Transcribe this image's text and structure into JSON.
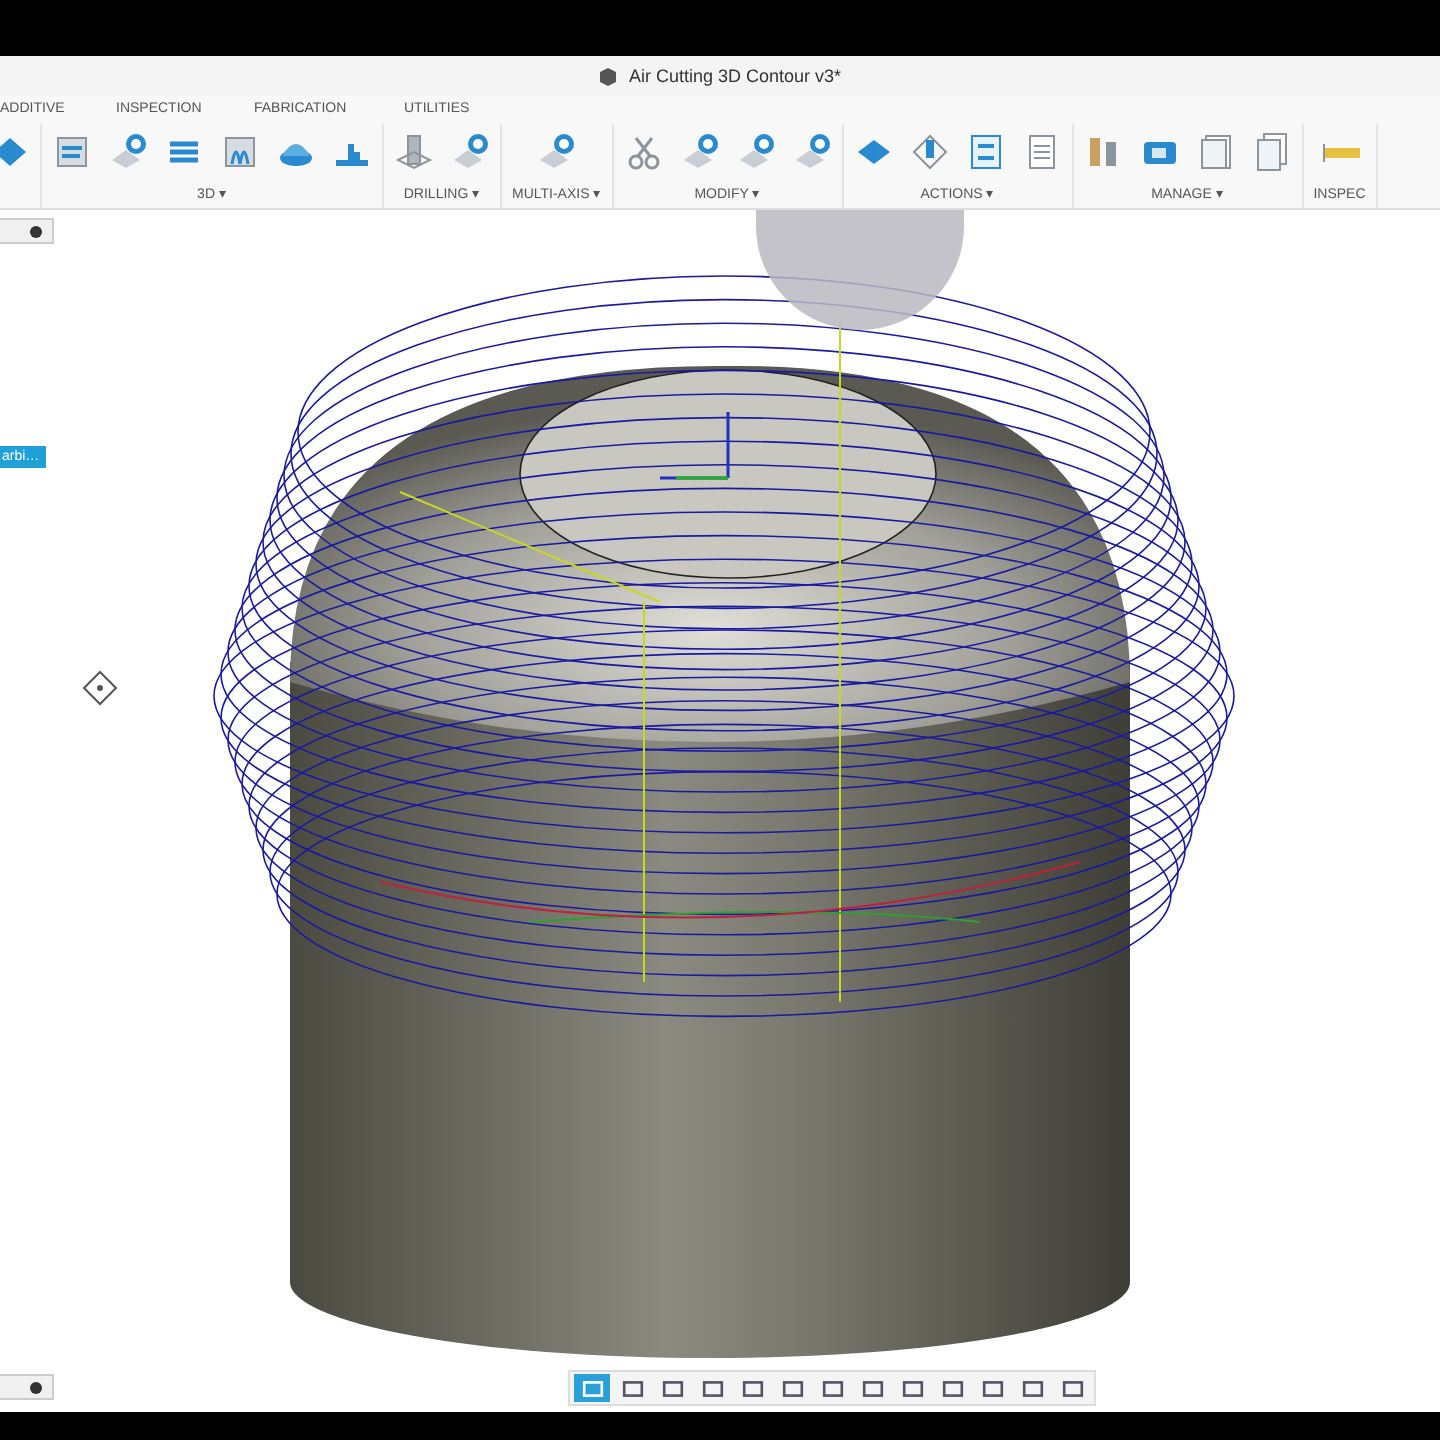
{
  "window": {
    "title": "Air Cutting 3D Contour v3*"
  },
  "ribbon_tabs": [
    {
      "label": "ADDITIVE"
    },
    {
      "label": "INSPECTION"
    },
    {
      "label": "FABRICATION"
    },
    {
      "label": "UTILITIES"
    }
  ],
  "tool_groups": [
    {
      "label": "3D ▾"
    },
    {
      "label": "DRILLING ▾"
    },
    {
      "label": "MULTI-AXIS ▾"
    },
    {
      "label": "MODIFY ▾"
    },
    {
      "label": "ACTIONS ▾"
    },
    {
      "label": "MANAGE ▾"
    },
    {
      "label": "INSPEC"
    }
  ],
  "browser_tag": {
    "label": "arbi…"
  },
  "nav_tools": [
    {
      "selected": true
    },
    {
      "selected": false
    },
    {
      "selected": false
    },
    {
      "selected": false
    },
    {
      "selected": false
    },
    {
      "selected": false
    },
    {
      "selected": false
    },
    {
      "selected": false
    },
    {
      "selected": false
    },
    {
      "selected": false
    },
    {
      "selected": false
    },
    {
      "selected": false
    },
    {
      "selected": false
    }
  ]
}
